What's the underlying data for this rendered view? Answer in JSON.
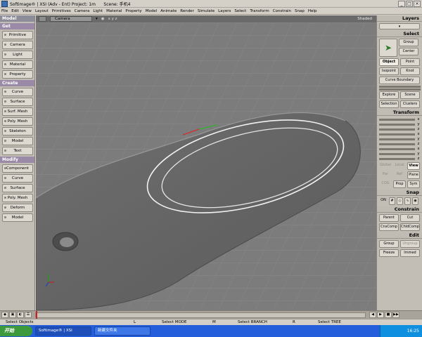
{
  "window": {
    "title": "Softimage® | XSI (Adv - Ent) Project: 1m      Scene: 手机4"
  },
  "menu": [
    "File",
    "Edit",
    "View",
    "Layout",
    "Primitives",
    "Camera",
    "Light",
    "Material",
    "Property",
    "Model",
    "Animate",
    "Render",
    "Simulate",
    "Layers",
    "Select",
    "Transform",
    "Constrain",
    "Snap",
    "Help"
  ],
  "left_panel": {
    "header": "Model",
    "get": {
      "title": "Get",
      "items": [
        "Primitive",
        "Camera",
        "Light",
        "Material",
        "Property"
      ]
    },
    "create": {
      "title": "Create",
      "items": [
        "Curve",
        "Surface",
        "Surf. Mesh",
        "Poly. Mesh",
        "Skeleton",
        "Model",
        "Text"
      ]
    },
    "modify": {
      "title": "Modify",
      "items": [
        "Component",
        "Curve",
        "Surface",
        "Poly. Mesh",
        "Deform",
        "Model"
      ]
    }
  },
  "viewport": {
    "camera_label": "Camera",
    "xyz": "x y z",
    "mode": "Shaded"
  },
  "right_panel": {
    "layers": "Layers",
    "select": {
      "title": "Select",
      "group": "Group",
      "center": "Center",
      "object": "Object",
      "point": "Point",
      "isopoint": "Isopoint",
      "knot": "Knot",
      "curve_boundary": "Curve Boundary",
      "explore": "Explore",
      "scene": "Scene",
      "selection": "Selection",
      "clusters": "Clusters"
    },
    "transform": {
      "title": "Transform",
      "axes": [
        "x",
        "y",
        "z"
      ],
      "global": "Global",
      "local": "Local",
      "view": "View",
      "par": "Par",
      "ref": "Ref",
      "plane": "Plane",
      "cog": "COG",
      "prop": "Prop",
      "sym": "Sym"
    },
    "snap": {
      "title": "Snap",
      "on": "ON"
    },
    "constrain": {
      "title": "Constrain",
      "parent": "Parent",
      "cut": "Cut",
      "cnscomp": "CnsComp",
      "chldcomp": "ChldComp"
    },
    "edit": {
      "title": "Edit",
      "group": "Group",
      "ungroup": "Ungroup",
      "freeze": "Freeze",
      "immed": "Immed"
    }
  },
  "status": {
    "s1": "Select Objects",
    "l": "L",
    "s2": "Select MODE",
    "m": "M",
    "s3": "Select BRANCH",
    "r": "R",
    "s4": "Select TREE"
  },
  "taskbar": {
    "start": "开始",
    "task1": "Softimage® | XSI",
    "task2": "新建文件夹",
    "clock": "16:25"
  }
}
